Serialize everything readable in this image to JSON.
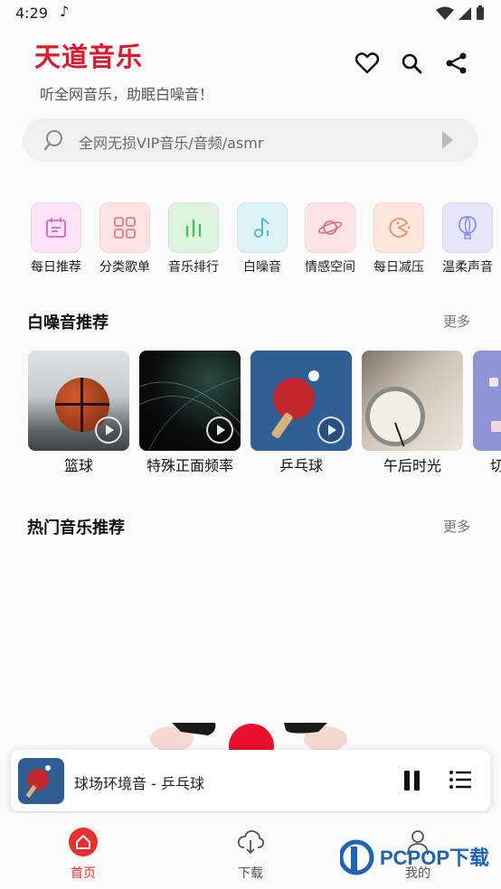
{
  "status_bar": {
    "time": "4:29"
  },
  "header": {
    "app_title": "天道音乐",
    "subtitle": "听全网音乐，助眠白噪音！"
  },
  "search": {
    "placeholder": "全网无损VIP音乐/音频/asmr"
  },
  "categories": [
    {
      "label": "每日推荐",
      "icon": "calendar-icon",
      "bg": "#fde3f6",
      "color": "#e55bd3"
    },
    {
      "label": "分类歌单",
      "icon": "grid-icon",
      "bg": "#fde4e4",
      "color": "#ee7b7b"
    },
    {
      "label": "音乐排行",
      "icon": "bar-chart-icon",
      "bg": "#ddf5df",
      "color": "#4cbd62"
    },
    {
      "label": "白噪音",
      "icon": "music-note-icon",
      "bg": "#dcf4f7",
      "color": "#45b7c9"
    },
    {
      "label": "情感空间",
      "icon": "planet-icon",
      "bg": "#fde3e6",
      "color": "#e4707f"
    },
    {
      "label": "每日减压",
      "icon": "pacman-icon",
      "bg": "#fde6dc",
      "color": "#ee8d63"
    },
    {
      "label": "温柔声音",
      "icon": "balloon-icon",
      "bg": "#e6e6fb",
      "color": "#8c8be4"
    }
  ],
  "white_noise": {
    "title": "白噪音推荐",
    "more": "更多",
    "items": [
      {
        "label": "篮球"
      },
      {
        "label": "特殊正面频率"
      },
      {
        "label": "乒乓球"
      },
      {
        "label": "午后时光"
      },
      {
        "label": "切"
      }
    ]
  },
  "hot_music": {
    "title": "热门音乐推荐",
    "more": "更多"
  },
  "player": {
    "track": "球场环境音 - 乒乓球"
  },
  "bottom_nav": [
    {
      "label": "首页",
      "active": true
    },
    {
      "label": "下载",
      "active": false
    },
    {
      "label": "我的",
      "active": false
    }
  ],
  "watermark": {
    "text": "PCPOP下载"
  },
  "colors": {
    "brand": "#e0182d",
    "accent": "#e8302f"
  }
}
